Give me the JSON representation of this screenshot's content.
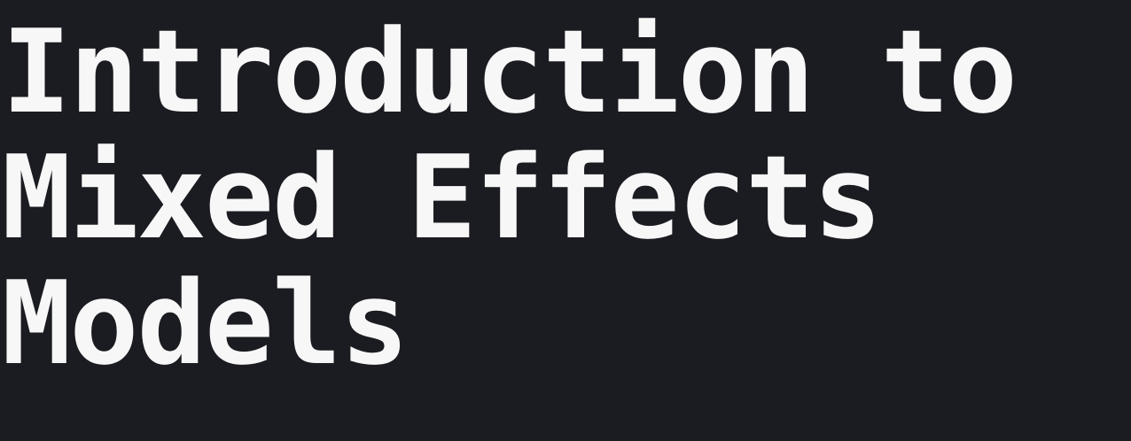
{
  "title": {
    "lines": [
      "Introduction to",
      "Mixed Effects",
      "Models"
    ]
  },
  "colors": {
    "background": "#1b1c21",
    "text": "#f7f7f7"
  }
}
